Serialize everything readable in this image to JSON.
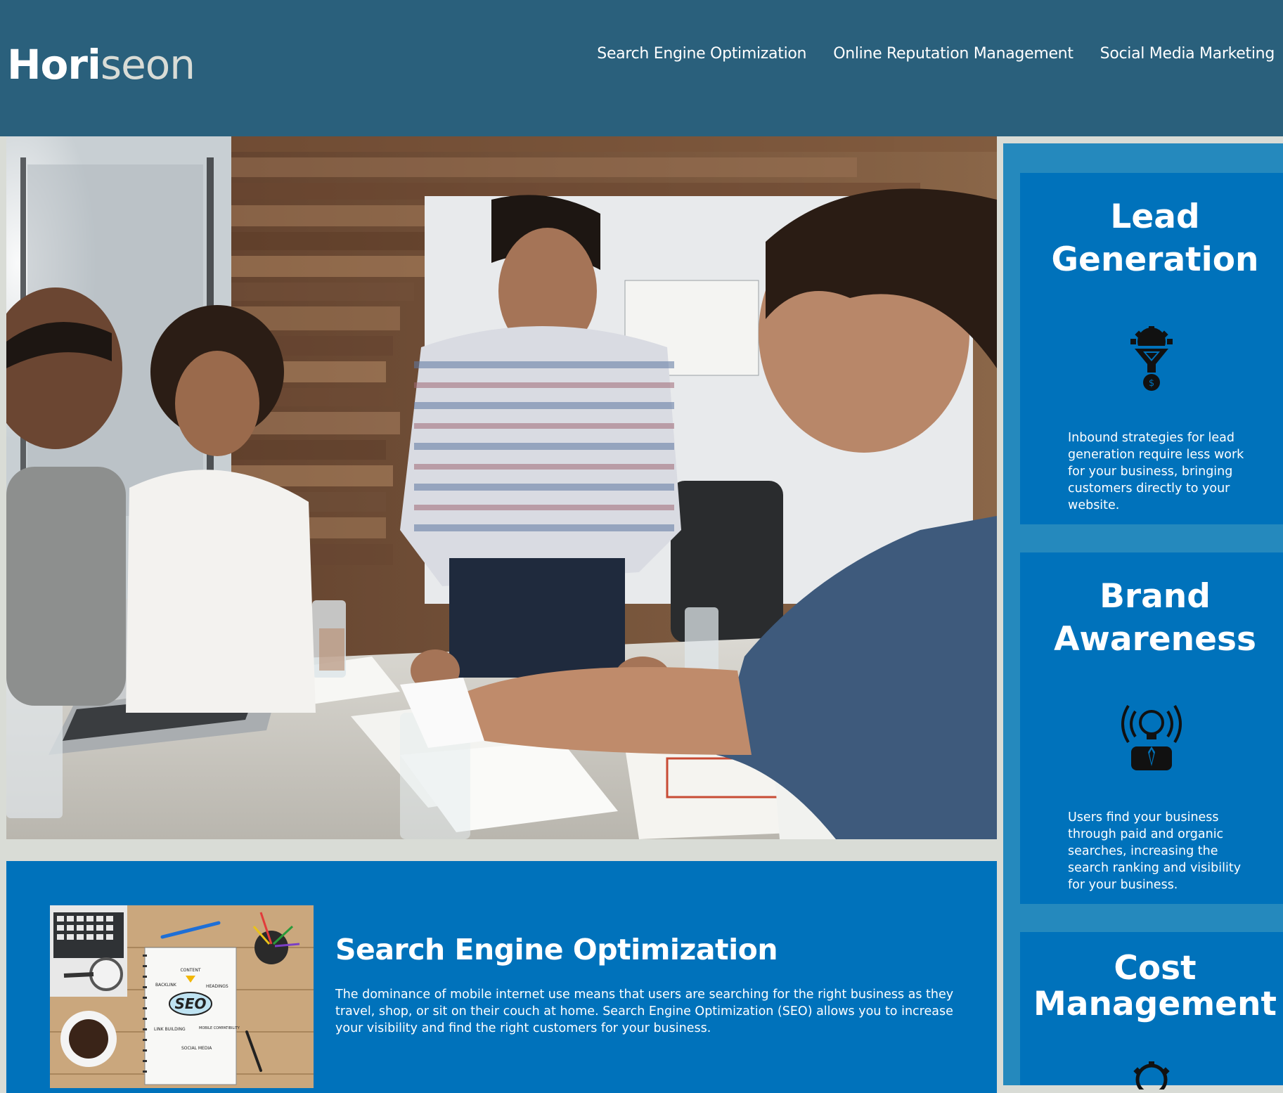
{
  "header": {
    "logo_main": "Hori",
    "logo_accent": "seon",
    "nav": [
      "Search Engine Optimization",
      "Online Reputation Management",
      "Social Media Marketing"
    ]
  },
  "content": {
    "seo": {
      "title": "Search Engine Optimization",
      "body": "The dominance of mobile internet use means that users are searching for the right business as they travel, shop, or sit on their couch at home. Search Engine Optimization (SEO) allows you to increase your visibility and find the right customers for your business.",
      "image_words": {
        "center": "SEO",
        "content": "CONTENT",
        "backlink": "BACKLINK",
        "headings": "HEADINGS",
        "link_building": "LINK BUILDING",
        "mobile": "MOBILE COMPATIBILITY",
        "social": "SOCIAL MEDIA"
      }
    }
  },
  "sidebar": {
    "cards": [
      {
        "title_line1": "Lead",
        "title_line2": "Generation",
        "icon": "lead-generation-funnel-icon",
        "body": "Inbound strategies for lead generation require less work for your business, bringing customers directly to your website."
      },
      {
        "title_line1": "Brand",
        "title_line2": "Awareness",
        "icon": "brand-awareness-lightbulb-icon",
        "body": "Users find your business through paid and organic searches, increasing the search ranking and visibility for your business."
      },
      {
        "title_line1": "Cost",
        "title_line2": "Management",
        "icon": "cost-management-gear-icon",
        "body": ""
      }
    ]
  },
  "colors": {
    "header_bg": "#2a607c",
    "page_bg": "#d9dcd6",
    "content_bg": "#0072bb",
    "sidebar_bg": "#2589bd",
    "text": "#ffffff"
  }
}
